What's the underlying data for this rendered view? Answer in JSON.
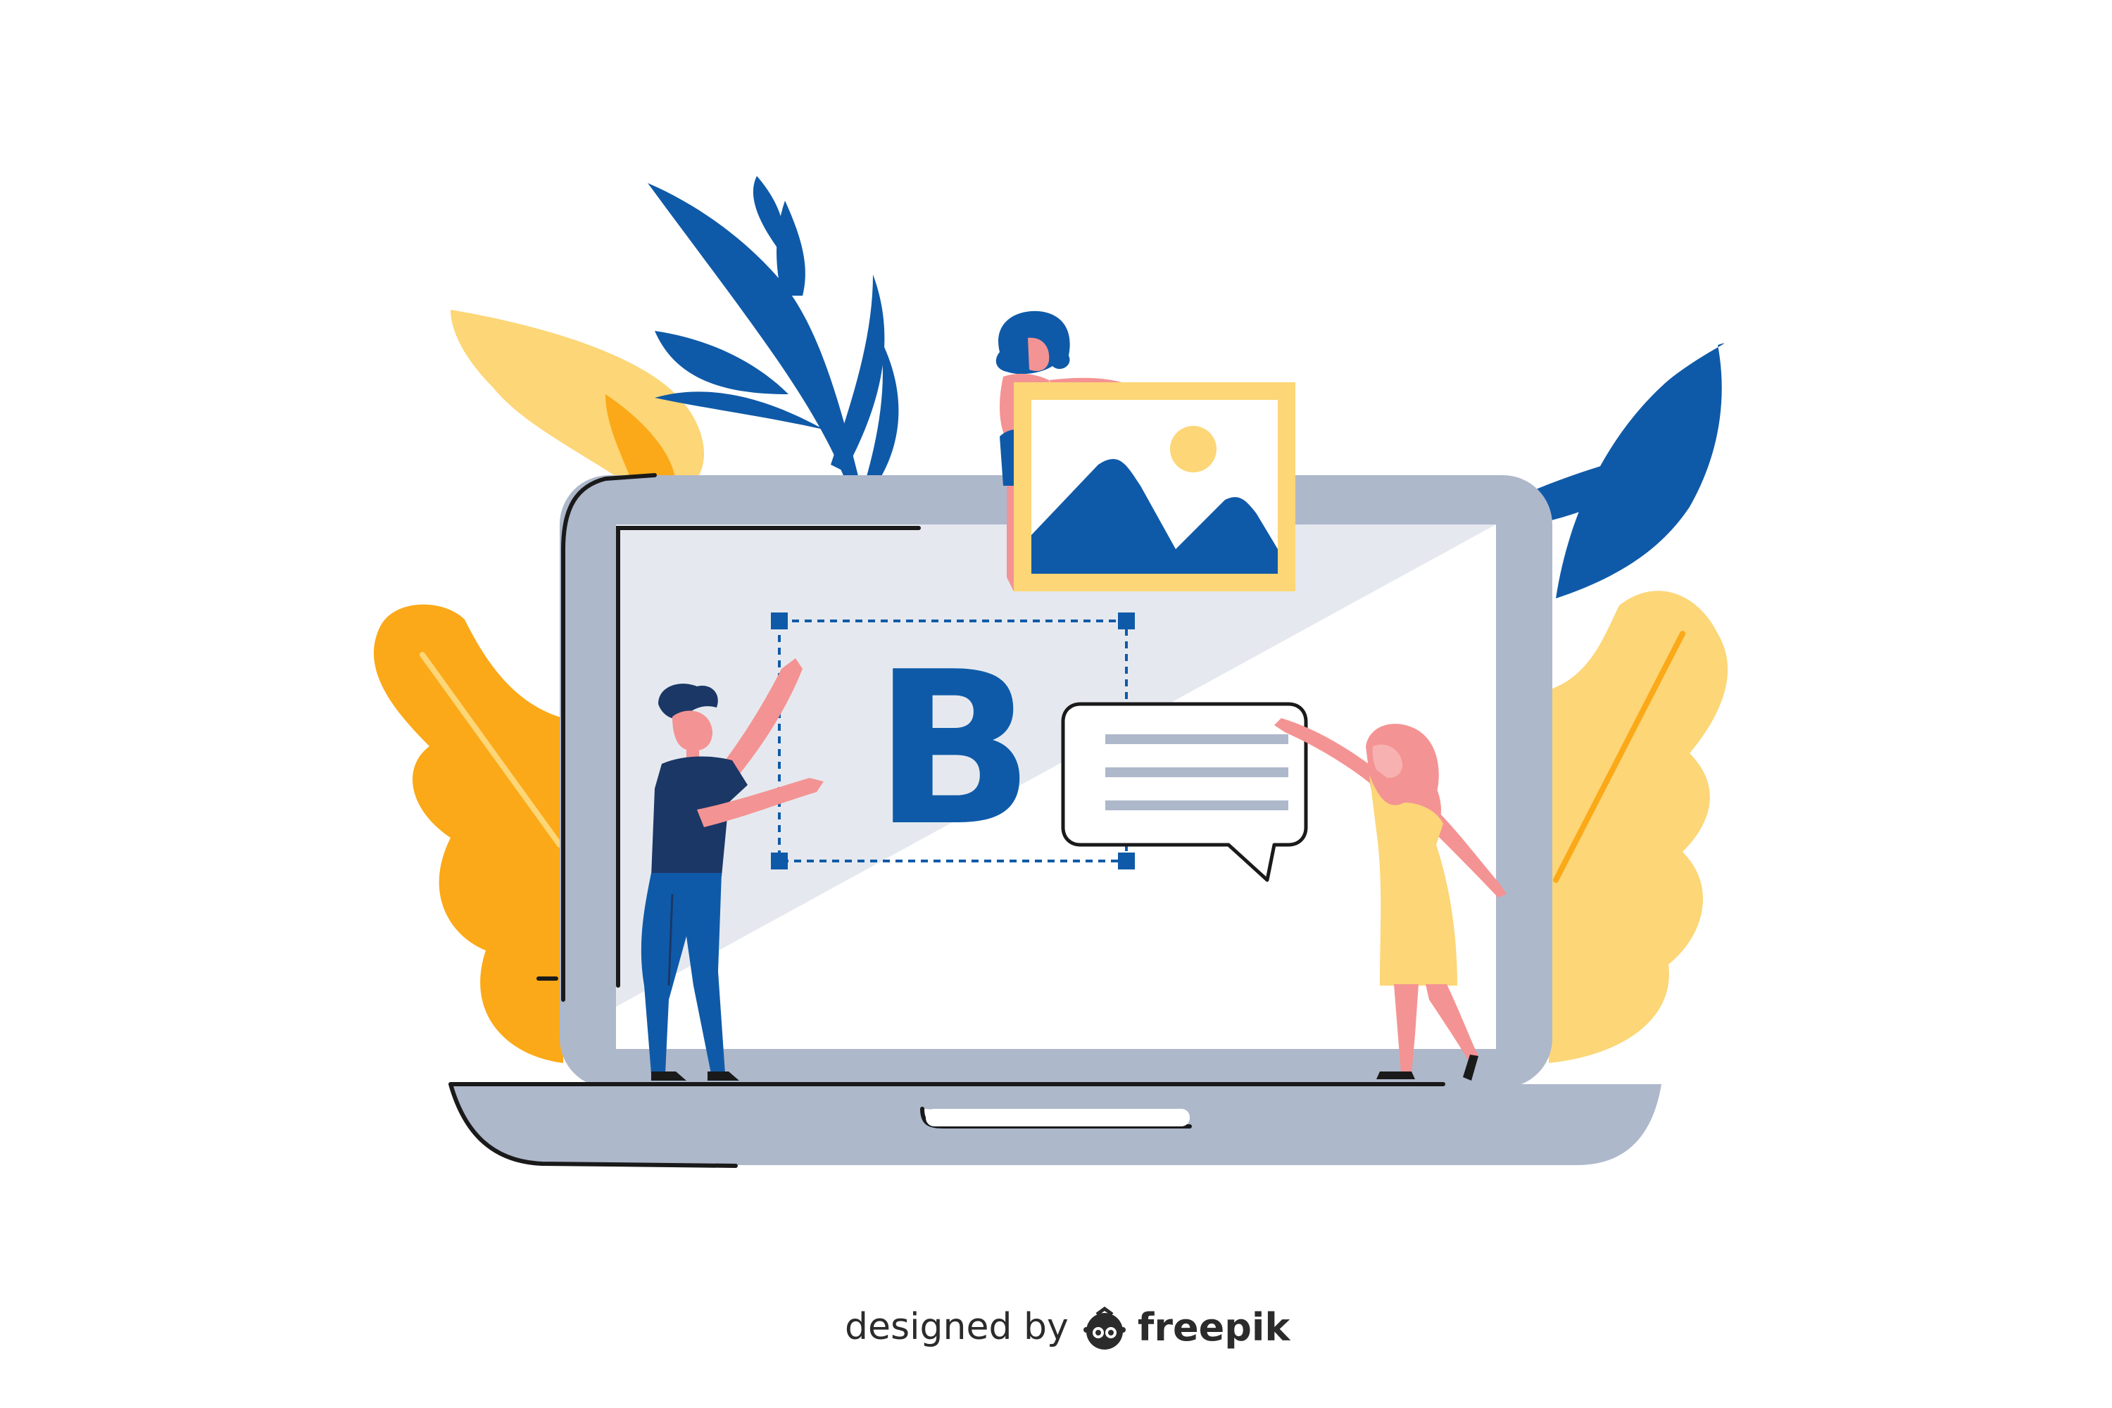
{
  "illustration": {
    "screen_letter": "B"
  },
  "credit": {
    "prefix": "designed by",
    "brand": "freepik",
    "logo_icon": "freepik-logo-icon"
  },
  "colors": {
    "navy": "#0f5aa8",
    "laptop_gray": "#aeb8cb",
    "screen_light": "#e5e9ef",
    "yellow": "#fcd677",
    "orange": "#fba918",
    "pink": "#f49393"
  }
}
